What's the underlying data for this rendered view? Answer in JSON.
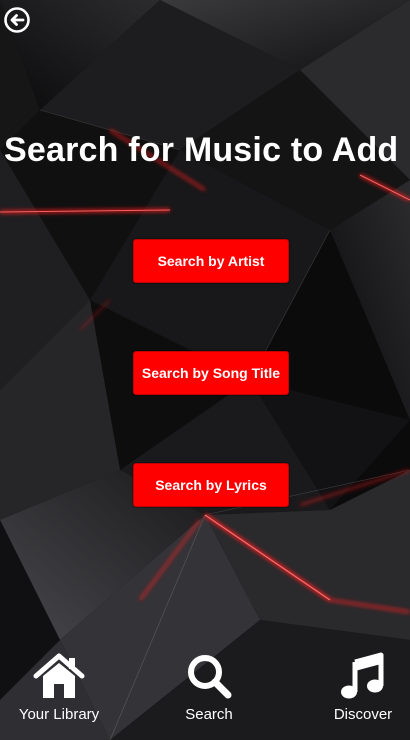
{
  "screen": {
    "title": "Search for Music to Add"
  },
  "header": {
    "back_icon": "back-arrow-circle-icon"
  },
  "search_options": [
    {
      "label": "Search by Artist"
    },
    {
      "label": "Search by Song Title"
    },
    {
      "label": "Search by Lyrics"
    }
  ],
  "tab_bar": {
    "items": [
      {
        "label": "Your Library",
        "icon": "home-icon"
      },
      {
        "label": "Search",
        "icon": "search-icon"
      },
      {
        "label": "Discover",
        "icon": "music-note-icon"
      }
    ]
  },
  "colors": {
    "accent": "#ff0000",
    "background": "#0b0b0c",
    "text": "#ffffff"
  }
}
